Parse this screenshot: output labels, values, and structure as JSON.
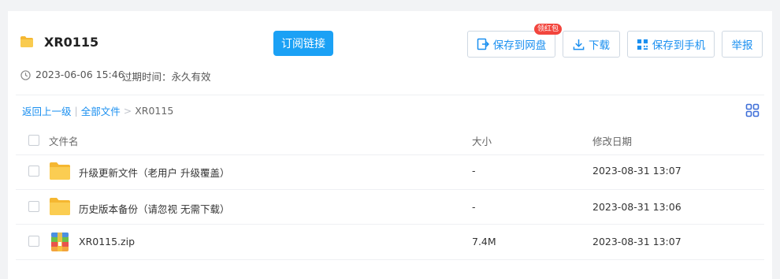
{
  "header": {
    "title": "XR0115",
    "subscribe_label": "订阅链接",
    "badge_label": "领红包",
    "actions": {
      "save_to_disk": "保存到网盘",
      "download": "下载",
      "save_to_phone": "保存到手机",
      "report": "举报"
    }
  },
  "meta": {
    "date": "2023-06-06 15:46",
    "expire": "过期时间：永久有效"
  },
  "breadcrumb": {
    "back": "返回上一级",
    "sep1": "|",
    "all_files": "全部文件",
    "sep2": ">",
    "current": "XR0115"
  },
  "table": {
    "columns": {
      "name": "文件名",
      "size": "大小",
      "modified": "修改日期"
    },
    "rows": [
      {
        "name": "升级更新文件（老用户 升级覆盖）",
        "size": "-",
        "modified": "2023-08-31 13:07",
        "icon": "folder-icon"
      },
      {
        "name": "历史版本备份（请忽视 无需下载）",
        "size": "-",
        "modified": "2023-08-31 13:06",
        "icon": "folder-icon"
      },
      {
        "name": "XR0115.zip",
        "size": "7.4M",
        "modified": "2023-08-31 13:07",
        "icon": "zip-file-icon"
      }
    ]
  },
  "colors": {
    "accent": "#1a8ff0",
    "subscribe_bg": "#1ba1f5",
    "badge": "#f2453d",
    "folder": "#f8c54a"
  }
}
